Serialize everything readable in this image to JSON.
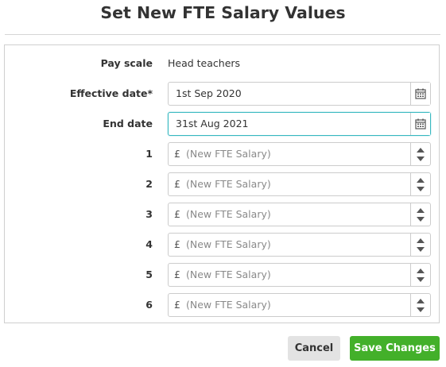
{
  "dialog": {
    "title": "Set New FTE Salary Values"
  },
  "form": {
    "pay_scale": {
      "label": "Pay scale",
      "value": "Head teachers"
    },
    "effective_date": {
      "label": "Effective date*",
      "value": "1st Sep 2020",
      "icon": "calendar-icon"
    },
    "end_date": {
      "label": "End date",
      "value": "31st Aug 2021",
      "icon": "calendar-icon",
      "focused": true
    },
    "salary_points": [
      {
        "label": "1",
        "currency": "£",
        "placeholder": "(New FTE Salary)",
        "value": ""
      },
      {
        "label": "2",
        "currency": "£",
        "placeholder": "(New FTE Salary)",
        "value": ""
      },
      {
        "label": "3",
        "currency": "£",
        "placeholder": "(New FTE Salary)",
        "value": ""
      },
      {
        "label": "4",
        "currency": "£",
        "placeholder": "(New FTE Salary)",
        "value": ""
      },
      {
        "label": "5",
        "currency": "£",
        "placeholder": "(New FTE Salary)",
        "value": ""
      },
      {
        "label": "6",
        "currency": "£",
        "placeholder": "(New FTE Salary)",
        "value": ""
      }
    ]
  },
  "footer": {
    "cancel_label": "Cancel",
    "save_label": "Save Changes"
  },
  "colors": {
    "save_button": "#43b02a",
    "cancel_button": "#e3e3e3",
    "focus_border": "#37b8c0"
  }
}
